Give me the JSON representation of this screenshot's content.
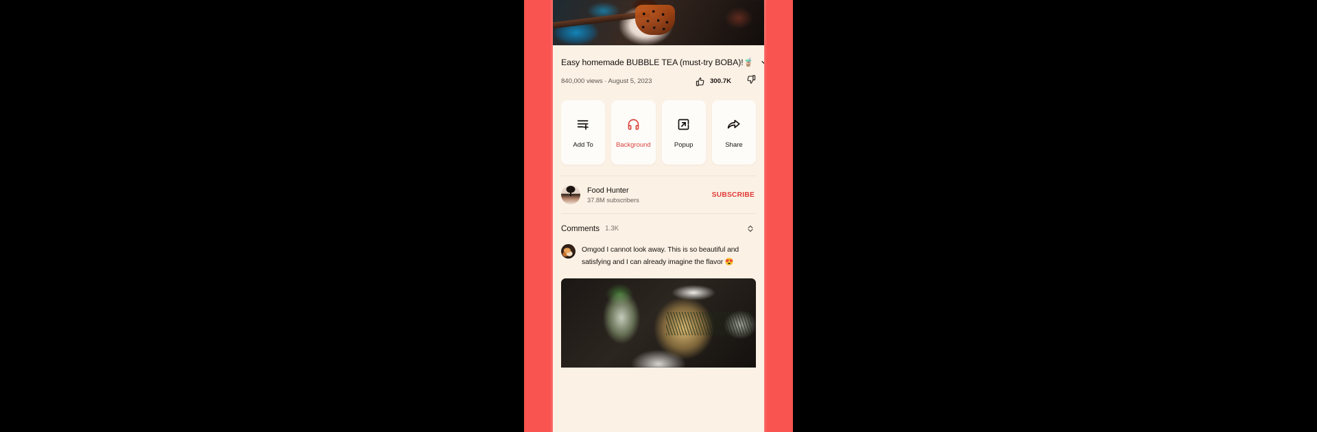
{
  "app": {
    "name": "youtube-mobile-video-page",
    "frame_color": "#f9544f",
    "screen_background": "#fbf1e5",
    "card_background": "#fefcf9",
    "accent_color": "#d9453f"
  },
  "player": {
    "thumbnail_alt": "hand holding a bubble tea cup with tapioca pearls"
  },
  "video": {
    "title": "Easy homemade BUBBLE TEA (must-try BOBA)!",
    "title_emoji": "🧋",
    "expand_icon": "chevron-down-icon",
    "views": "840,000 views",
    "separator": "·",
    "date": "August 5, 2023",
    "meta_line": "840,000 views · August 5, 2023",
    "like_icon": "thumbs-up-icon",
    "like_count": "300.7K",
    "dislike_icon": "thumbs-down-icon"
  },
  "actions": [
    {
      "label": "Add To",
      "icon": "playlist-add-icon",
      "accent": false
    },
    {
      "label": "Background",
      "icon": "headphones-icon",
      "accent": true
    },
    {
      "label": "Popup",
      "icon": "picture-in-picture-icon",
      "accent": false
    },
    {
      "label": "Share",
      "icon": "share-arrow-icon",
      "accent": false
    }
  ],
  "channel": {
    "avatar": "channel-avatar",
    "name": "Food Hunter",
    "subscribers": "37.8M subscribers",
    "subscribe_label": "SUBSCRIBE"
  },
  "comments": {
    "title": "Comments",
    "count": "1.3K",
    "sort_icon": "expand-collapse-icon",
    "top_comment": {
      "avatar": "comment-avatar",
      "text": "Omgod I cannot look away. This is so beautiful and satisfying and I can already imagine the flavor 😍"
    }
  },
  "suggested": {
    "thumbnail_alt": "glass teapot with tea leaves beside an iced mint drink"
  }
}
